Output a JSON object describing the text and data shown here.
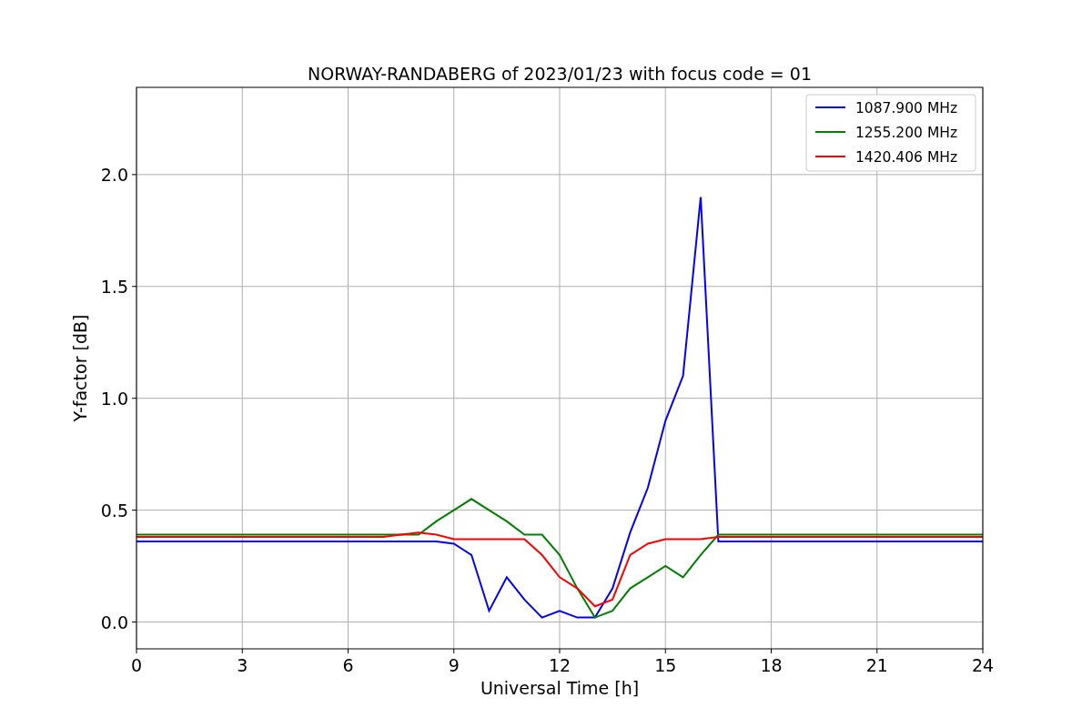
{
  "chart_data": {
    "type": "line",
    "title": "NORWAY-RANDABERG of 2023/01/23 with focus code = 01",
    "xlabel": "Universal Time [h]",
    "ylabel": "Y-factor [dB]",
    "x": [
      0,
      0.5,
      1,
      1.5,
      2,
      2.5,
      3,
      3.5,
      4,
      4.5,
      5,
      5.5,
      6,
      6.5,
      7,
      7.5,
      8,
      8.5,
      9,
      9.5,
      10,
      10.5,
      11,
      11.5,
      12,
      12.5,
      13,
      13.5,
      14,
      14.5,
      15,
      15.5,
      16,
      16.5,
      17,
      17.5,
      18,
      18.5,
      19,
      19.5,
      20,
      20.5,
      21,
      21.5,
      22,
      22.5,
      23,
      23.5,
      24
    ],
    "series": [
      {
        "name": "1087.900 MHz",
        "color": "#0000ff",
        "values": [
          0.36,
          0.36,
          0.36,
          0.36,
          0.36,
          0.36,
          0.36,
          0.36,
          0.36,
          0.36,
          0.36,
          0.36,
          0.36,
          0.36,
          0.36,
          0.36,
          0.36,
          0.36,
          0.35,
          0.3,
          0.05,
          0.2,
          0.1,
          0.02,
          0.05,
          0.02,
          0.02,
          0.15,
          0.4,
          0.6,
          0.9,
          1.1,
          1.9,
          0.36,
          0.36,
          0.36,
          0.36,
          0.36,
          0.36,
          0.36,
          0.36,
          0.36,
          0.36,
          0.36,
          0.36,
          0.36,
          0.36,
          0.36,
          0.36
        ]
      },
      {
        "name": "1255.200 MHz",
        "color": "#008000",
        "values": [
          0.39,
          0.39,
          0.39,
          0.39,
          0.39,
          0.39,
          0.39,
          0.39,
          0.39,
          0.39,
          0.39,
          0.39,
          0.39,
          0.39,
          0.39,
          0.39,
          0.39,
          0.45,
          0.5,
          0.55,
          0.5,
          0.45,
          0.39,
          0.39,
          0.3,
          0.15,
          0.02,
          0.05,
          0.15,
          0.2,
          0.25,
          0.2,
          0.3,
          0.39,
          0.39,
          0.39,
          0.39,
          0.39,
          0.39,
          0.39,
          0.39,
          0.39,
          0.39,
          0.39,
          0.39,
          0.39,
          0.39,
          0.39,
          0.39
        ]
      },
      {
        "name": "1420.406 MHz",
        "color": "#ff0000",
        "values": [
          0.38,
          0.38,
          0.38,
          0.38,
          0.38,
          0.38,
          0.38,
          0.38,
          0.38,
          0.38,
          0.38,
          0.38,
          0.38,
          0.38,
          0.38,
          0.39,
          0.4,
          0.39,
          0.37,
          0.37,
          0.37,
          0.37,
          0.37,
          0.3,
          0.2,
          0.15,
          0.07,
          0.1,
          0.3,
          0.35,
          0.37,
          0.37,
          0.37,
          0.38,
          0.38,
          0.38,
          0.38,
          0.38,
          0.38,
          0.38,
          0.38,
          0.38,
          0.38,
          0.38,
          0.38,
          0.38,
          0.38,
          0.38,
          0.38
        ]
      }
    ],
    "xlim": [
      0,
      24
    ],
    "ylim": [
      -0.12,
      2.39
    ],
    "xticks": [
      0,
      3,
      6,
      9,
      12,
      15,
      18,
      21,
      24
    ],
    "yticks": [
      {
        "value": 0,
        "label": "0.0"
      },
      {
        "value": 0.5,
        "label": "0.5"
      },
      {
        "value": 1,
        "label": "1.0"
      },
      {
        "value": 1.5,
        "label": "1.5"
      },
      {
        "value": 2,
        "label": "2.0"
      }
    ],
    "grid": true,
    "legend": true
  }
}
